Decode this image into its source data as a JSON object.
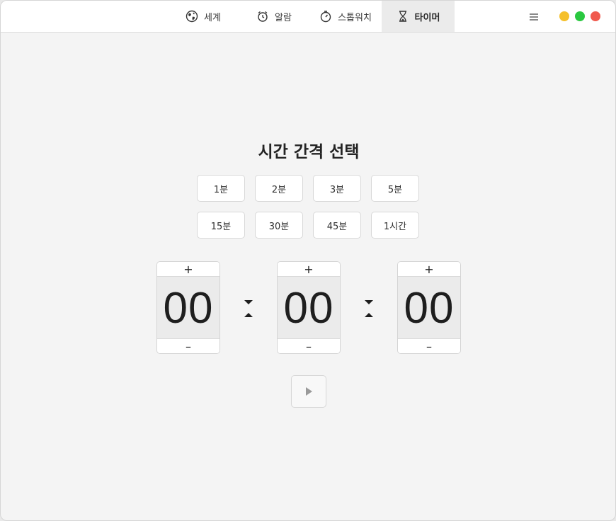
{
  "tabs": [
    {
      "label": "세계",
      "icon": "globe-icon"
    },
    {
      "label": "알람",
      "icon": "alarm-clock-icon"
    },
    {
      "label": "스톱워치",
      "icon": "stopwatch-icon"
    },
    {
      "label": "타이머",
      "icon": "hourglass-icon",
      "active": true
    }
  ],
  "menu_icon": "menu-icon",
  "window_controls": {
    "minimize_color": "#f5c02b",
    "maximize_color": "#2ac840",
    "close_color": "#f05a4e"
  },
  "heading": "시간 간격 선택",
  "presets": [
    "1분",
    "2분",
    "3분",
    "5분",
    "15분",
    "30분",
    "45분",
    "1시간"
  ],
  "spinners": {
    "hours": {
      "value": "00",
      "increment": "+",
      "decrement": "–"
    },
    "minutes": {
      "value": "00",
      "increment": "+",
      "decrement": "–"
    },
    "seconds": {
      "value": "00",
      "increment": "+",
      "decrement": "–"
    }
  },
  "start_button_icon": "play-icon"
}
